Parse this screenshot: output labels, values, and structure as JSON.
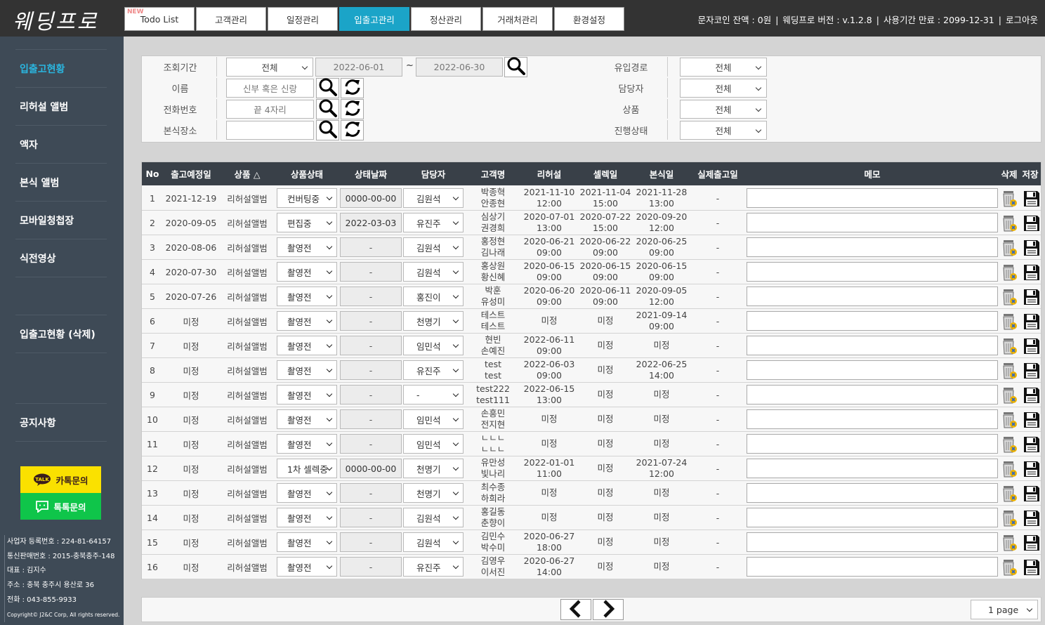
{
  "app": {
    "logo": "웨딩프로"
  },
  "tabs": [
    {
      "label": "Todo List",
      "new_badge": "NEW"
    },
    {
      "label": "고객관리"
    },
    {
      "label": "일정관리"
    },
    {
      "label": "입출고관리"
    },
    {
      "label": "정산관리"
    },
    {
      "label": "거래처관리"
    },
    {
      "label": "환경설정"
    }
  ],
  "top_info": {
    "coin": "문자코인 잔액 : 0원",
    "version": "웨딩프로 버전 : v.1.2.8",
    "expiry": "사용기간 만료 : 2099-12-31",
    "logout": "로그아웃"
  },
  "sidebar": {
    "items": [
      {
        "label": "입출고현황"
      },
      {
        "label": "리허설 앨범"
      },
      {
        "label": "액자"
      },
      {
        "label": "본식 앨범"
      },
      {
        "label": "모바일청첩장"
      },
      {
        "label": "식전영상"
      },
      {
        "label": "입출고현황 (삭제)"
      },
      {
        "label": "공지사항"
      }
    ],
    "kakao_label": "카톡문의",
    "kakao_badge": "TALK",
    "talk_label": "톡톡문의",
    "footer": [
      "사업자 등록번호 : 224-81-64157",
      "통신판매번호 : 2015-충북충주-148",
      "대표 : 김지수",
      "주소 : 충북 충주시 용산로 36",
      "전화 : 043-855-9933",
      "Copyright© J2&C Corp, All rights reserved."
    ]
  },
  "filter": {
    "period_label": "조회기간",
    "period_value": "전체",
    "date_from": "2022-06-01",
    "tilde": "~",
    "date_to": "2022-06-30",
    "name_label": "이름",
    "name_placeholder": "신부 혹은 신랑",
    "phone_label": "전화번호",
    "phone_placeholder": "끝 4자리",
    "venue_label": "본식장소",
    "venue_value": "",
    "channel_label": "유입경로",
    "channel_value": "전체",
    "manager_label": "담당자",
    "manager_value": "전체",
    "product_label": "상품",
    "product_value": "전체",
    "progress_label": "진행상태",
    "progress_value": "전체"
  },
  "table": {
    "headers": [
      "No",
      "출고예정일",
      "상품 △",
      "상품상태",
      "상태날짜",
      "담당자",
      "고객명",
      "리허설",
      "셀렉일",
      "본식일",
      "실제출고일",
      "메모",
      "삭제",
      "저장"
    ],
    "rows": [
      {
        "no": "1",
        "ship": "2021-12-19",
        "product": "리허설앨범",
        "status": "컨버팅중",
        "sdate": "0000-00-00",
        "manager": "김원석",
        "c1": "박종혁",
        "c2": "안종현",
        "r1": "2021-11-10",
        "r2": "12:00",
        "s1": "2021-11-04",
        "s2": "15:00",
        "w1": "2021-11-28",
        "w2": "13:00",
        "actual": "-"
      },
      {
        "no": "2",
        "ship": "2020-09-05",
        "product": "리허설앨범",
        "status": "편집중",
        "sdate": "2022-03-03",
        "manager": "유진주",
        "c1": "심상기",
        "c2": "권경희",
        "r1": "2020-07-01",
        "r2": "13:00",
        "s1": "2020-07-22",
        "s2": "15:00",
        "w1": "2020-09-20",
        "w2": "12:00",
        "actual": "-"
      },
      {
        "no": "3",
        "ship": "2020-08-06",
        "product": "리허설앨범",
        "status": "촬영전",
        "sdate": "-",
        "manager": "김원석",
        "c1": "홍정현",
        "c2": "김나래",
        "r1": "2020-06-21",
        "r2": "09:00",
        "s1": "2020-06-22",
        "s2": "09:00",
        "w1": "2020-06-25",
        "w2": "09:00",
        "actual": "-"
      },
      {
        "no": "4",
        "ship": "2020-07-30",
        "product": "리허설앨범",
        "status": "촬영전",
        "sdate": "-",
        "manager": "김원석",
        "c1": "홍상원",
        "c2": "황신혜",
        "r1": "2020-06-15",
        "r2": "09:00",
        "s1": "2020-06-15",
        "s2": "09:00",
        "w1": "2020-06-15",
        "w2": "09:00",
        "actual": "-"
      },
      {
        "no": "5",
        "ship": "2020-07-26",
        "product": "리허설앨범",
        "status": "촬영전",
        "sdate": "-",
        "manager": "홍진이",
        "c1": "박훈",
        "c2": "유성미",
        "r1": "2020-06-20",
        "r2": "09:00",
        "s1": "2020-06-11",
        "s2": "09:00",
        "w1": "2020-09-05",
        "w2": "12:00",
        "actual": "-"
      },
      {
        "no": "6",
        "ship": "미정",
        "product": "리허설앨범",
        "status": "촬영전",
        "sdate": "-",
        "manager": "천명기",
        "c1": "테스트",
        "c2": "테스트",
        "r1": "미정",
        "r2": "",
        "s1": "미정",
        "s2": "",
        "w1": "2021-09-14",
        "w2": "09:00",
        "actual": "-"
      },
      {
        "no": "7",
        "ship": "미정",
        "product": "리허설앨범",
        "status": "촬영전",
        "sdate": "-",
        "manager": "임민석",
        "c1": "현빈",
        "c2": "손예진",
        "r1": "2022-06-11",
        "r2": "09:00",
        "s1": "미정",
        "s2": "",
        "w1": "미정",
        "w2": "",
        "actual": "-"
      },
      {
        "no": "8",
        "ship": "미정",
        "product": "리허설앨범",
        "status": "촬영전",
        "sdate": "-",
        "manager": "유진주",
        "c1": "test",
        "c2": "test",
        "r1": "2022-06-03",
        "r2": "09:00",
        "s1": "미정",
        "s2": "",
        "w1": "2022-06-25",
        "w2": "14:00",
        "actual": "-"
      },
      {
        "no": "9",
        "ship": "미정",
        "product": "리허설앨범",
        "status": "촬영전",
        "sdate": "-",
        "manager": "-",
        "c1": "test222",
        "c2": "test111",
        "r1": "2022-06-15",
        "r2": "13:00",
        "s1": "미정",
        "s2": "",
        "w1": "미정",
        "w2": "",
        "actual": "-"
      },
      {
        "no": "10",
        "ship": "미정",
        "product": "리허설앨범",
        "status": "촬영전",
        "sdate": "-",
        "manager": "임민석",
        "c1": "손흥민",
        "c2": "전지현",
        "r1": "미정",
        "r2": "",
        "s1": "미정",
        "s2": "",
        "w1": "미정",
        "w2": "",
        "actual": "-"
      },
      {
        "no": "11",
        "ship": "미정",
        "product": "리허설앨범",
        "status": "촬영전",
        "sdate": "-",
        "manager": "임민석",
        "c1": "ㄴㄴㄴ",
        "c2": "ㄴㄴㄴ",
        "r1": "미정",
        "r2": "",
        "s1": "미정",
        "s2": "",
        "w1": "미정",
        "w2": "",
        "actual": "-"
      },
      {
        "no": "12",
        "ship": "미정",
        "product": "리허설앨범",
        "status": "1차 셀렉중",
        "sdate": "0000-00-00",
        "manager": "천명기",
        "c1": "유만성",
        "c2": "빛나리",
        "r1": "2022-01-01",
        "r2": "11:00",
        "s1": "미정",
        "s2": "",
        "w1": "2021-07-24",
        "w2": "12:00",
        "actual": "-"
      },
      {
        "no": "13",
        "ship": "미정",
        "product": "리허설앨범",
        "status": "촬영전",
        "sdate": "-",
        "manager": "천명기",
        "c1": "최수종",
        "c2": "하희라",
        "r1": "미정",
        "r2": "",
        "s1": "미정",
        "s2": "",
        "w1": "미정",
        "w2": "",
        "actual": "-"
      },
      {
        "no": "14",
        "ship": "미정",
        "product": "리허설앨범",
        "status": "촬영전",
        "sdate": "-",
        "manager": "김원석",
        "c1": "홍길동",
        "c2": "춘향이",
        "r1": "미정",
        "r2": "",
        "s1": "미정",
        "s2": "",
        "w1": "미정",
        "w2": "",
        "actual": "-"
      },
      {
        "no": "15",
        "ship": "미정",
        "product": "리허설앨범",
        "status": "촬영전",
        "sdate": "-",
        "manager": "김원석",
        "c1": "김민수",
        "c2": "박수미",
        "r1": "2020-06-27",
        "r2": "18:00",
        "s1": "미정",
        "s2": "",
        "w1": "미정",
        "w2": "",
        "actual": "-"
      },
      {
        "no": "16",
        "ship": "미정",
        "product": "리허설앨범",
        "status": "촬영전",
        "sdate": "-",
        "manager": "유진주",
        "c1": "김영우",
        "c2": "이서진",
        "r1": "2020-06-27",
        "r2": "14:00",
        "s1": "미정",
        "s2": "",
        "w1": "미정",
        "w2": "",
        "actual": "-"
      }
    ]
  },
  "pager": {
    "page_select": "1 page"
  },
  "colors": {
    "accent": "#1ba4c8",
    "sidebar": "#3e4a56",
    "topbar": "#333333",
    "header": "#394048",
    "kakao": "#fae100",
    "naver": "#0fc54a"
  },
  "icons": [
    "search-icon",
    "refresh-icon",
    "trash-icon",
    "save-icon",
    "chevron-left-icon",
    "chevron-right-icon"
  ]
}
